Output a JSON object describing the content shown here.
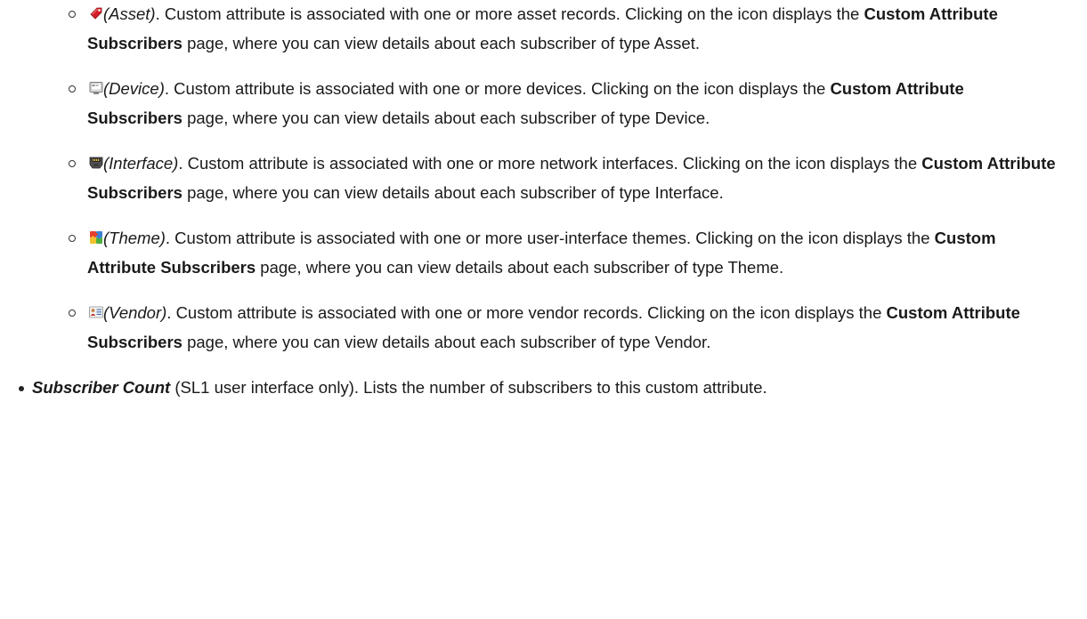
{
  "subscriber_types": [
    {
      "icon": "asset-tag-icon",
      "label": "(Asset)",
      "text_before": ". Custom attribute is associated with one or more asset records. Clicking on the icon displays the ",
      "bold": "Custom Attribute Subscribers",
      "text_after": " page, where you can view details about each subscriber of type Asset."
    },
    {
      "icon": "device-monitor-icon",
      "label": "(Device)",
      "text_before": ". Custom attribute is associated with one or more devices. Clicking on the icon displays the ",
      "bold": "Custom Attribute Subscribers",
      "text_after": " page, where you can view details about each subscriber of type Device."
    },
    {
      "icon": "network-interface-icon",
      "label": "(Interface)",
      "text_before": ". Custom attribute is associated with one or more network interfaces. Clicking on the icon displays the ",
      "bold": "Custom Attribute Subscribers",
      "text_after": " page, where you can view details about each subscriber of type Interface."
    },
    {
      "icon": "theme-puzzle-icon",
      "label": "(Theme)",
      "text_before": ". Custom attribute is associated with one or more user-interface themes. Clicking on the icon displays the ",
      "bold": "Custom Attribute Subscribers",
      "text_after": " page, where you can view details about each subscriber of type Theme."
    },
    {
      "icon": "vendor-card-icon",
      "label": "(Vendor)",
      "text_before": ". Custom attribute is associated with one or more vendor records. Clicking on the icon displays the ",
      "bold": "Custom Attribute Subscribers",
      "text_after": " page, where you can view details about each subscriber of type Vendor."
    }
  ],
  "subscriber_count": {
    "name": "Subscriber Count",
    "text": " (SL1 user interface only). Lists the number of subscribers to this custom attribute."
  },
  "colors": {
    "text": "#1a1a1a",
    "asset_icon": "#d4202a"
  }
}
